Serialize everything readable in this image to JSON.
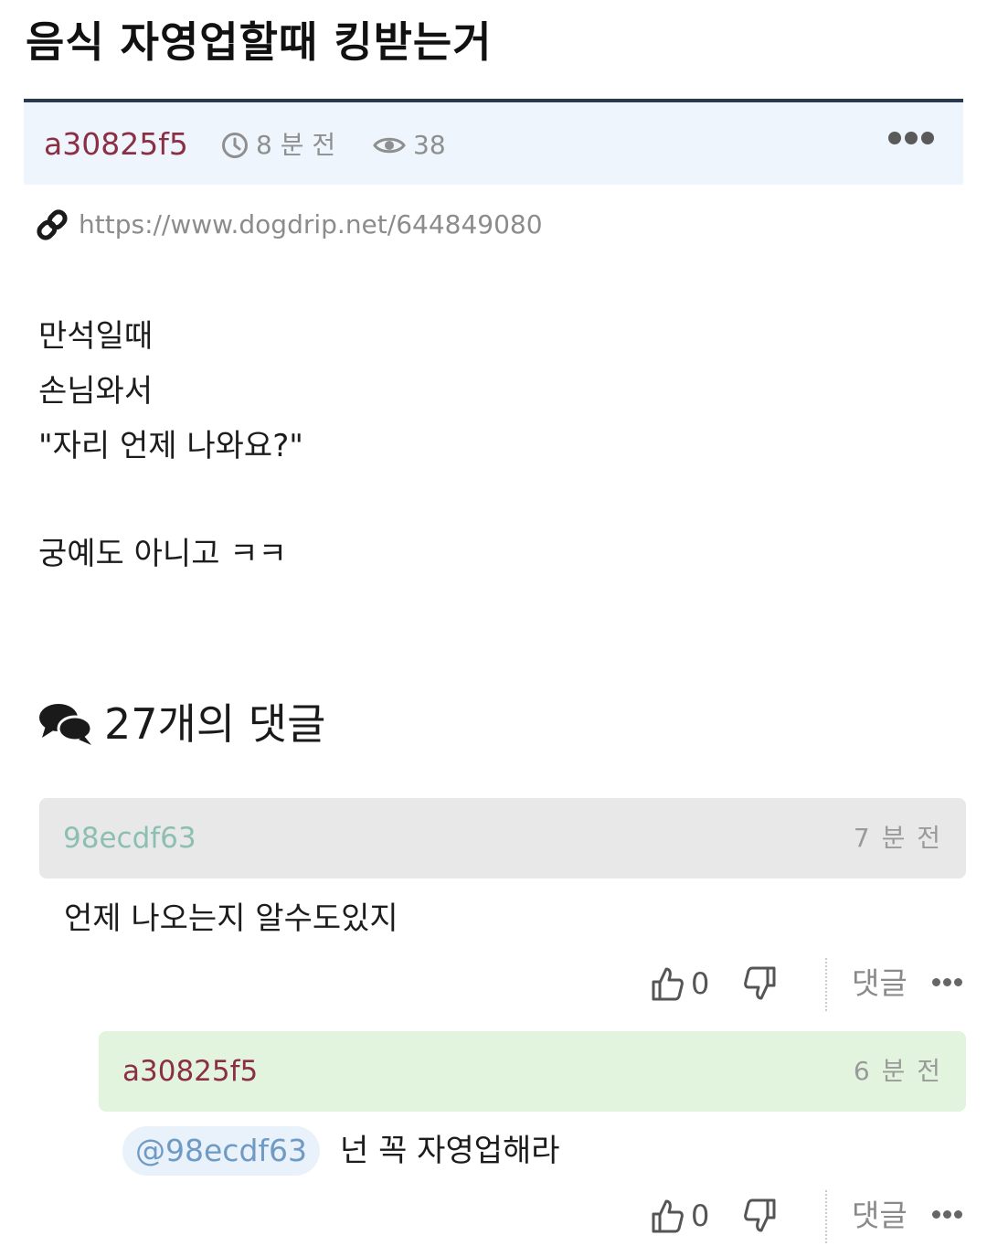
{
  "post": {
    "title": "음식 자영업할때 킹받는거",
    "author": "a30825f5",
    "time": "8 분 전",
    "views": "38",
    "url": "https://www.dogdrip.net/644849080",
    "body_lines": [
      "만석일때",
      "손님와서",
      "\"자리 언제 나와요?\"",
      "궁예도 아니고 ㅋㅋ"
    ]
  },
  "comments_header": {
    "title": "27개의 댓글"
  },
  "comments": [
    {
      "author": "98ecdf63",
      "author_color": "#8cbfb2",
      "time": "7 분 전",
      "text": "언제 나오는지 알수도있지",
      "likes": "0",
      "reply_label": "댓글"
    },
    {
      "author": "a30825f5",
      "author_color": "#8b2f45",
      "time": "6 분 전",
      "mention": "@98ecdf63",
      "text": "넌 꼭 자영업해라",
      "likes": "0",
      "reply_label": "댓글"
    }
  ],
  "colors": {
    "header_line": "#2a3a4c",
    "meta_bg": "#eef5fc",
    "comment_bg": "#e8e8e8",
    "reply_bg": "#e3f4de"
  },
  "icons": [
    "clock-icon",
    "eye-icon",
    "more-icon",
    "link-icon",
    "comments-icon",
    "thumbs-up-icon",
    "thumbs-down-icon"
  ]
}
